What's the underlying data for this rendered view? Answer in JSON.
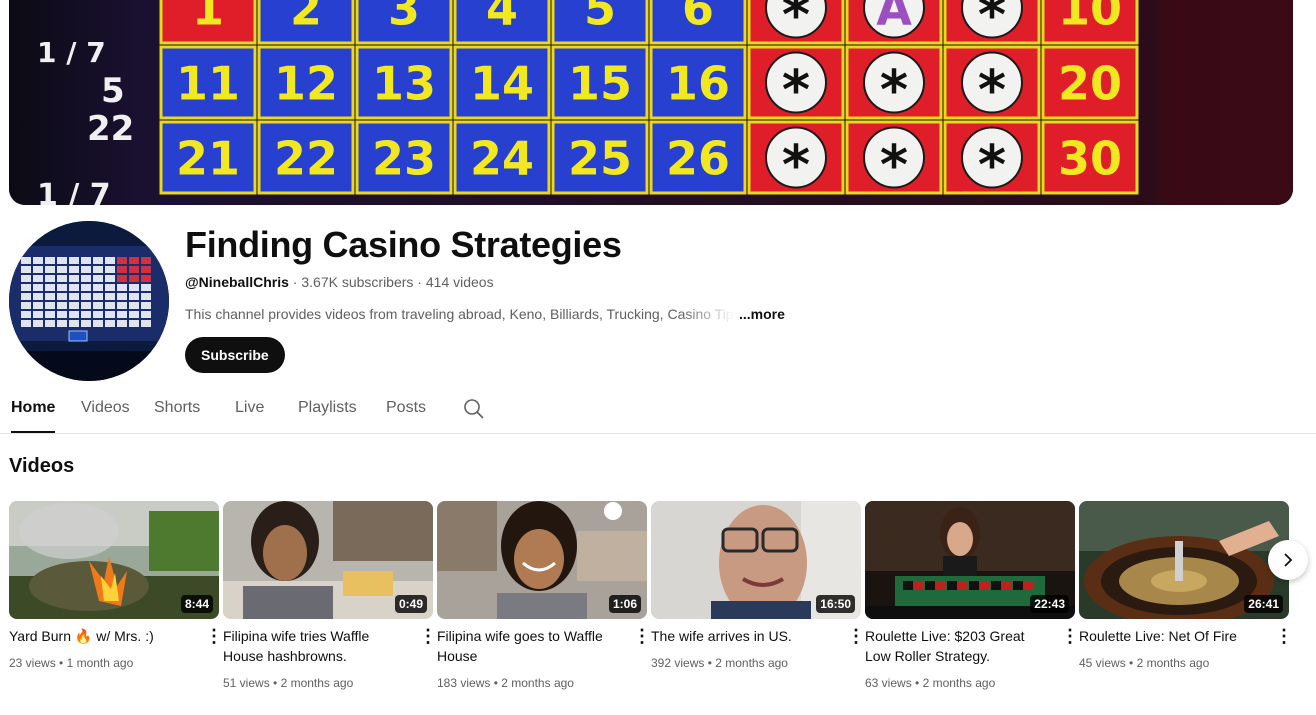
{
  "banner": {
    "side_numbers": [
      "1 / 7",
      "5",
      "22",
      "1 / 7"
    ],
    "row1": [
      "1",
      "2",
      "3",
      "4",
      "5",
      "6",
      "*",
      "A",
      "*",
      "10"
    ],
    "row2": [
      "11",
      "12",
      "13",
      "14",
      "15",
      "16",
      "*",
      "*",
      "*",
      "20"
    ],
    "row3": [
      "21",
      "22",
      "23",
      "24",
      "25",
      "26",
      "*",
      "*",
      "*",
      "30"
    ]
  },
  "channel": {
    "name": "Finding Casino Strategies",
    "handle": "@NineballChris",
    "separator": " · ",
    "subscribers": "3.67K subscribers",
    "videos_count": "414 videos",
    "description": "This channel provides videos from traveling abroad, Keno, Billiards, Trucking, Casino Tips",
    "more_label": "...more",
    "subscribe_label": "Subscribe"
  },
  "tabs": [
    {
      "label": "Home",
      "active": true
    },
    {
      "label": "Videos"
    },
    {
      "label": "Shorts"
    },
    {
      "label": "Live"
    },
    {
      "label": "Playlists"
    },
    {
      "label": "Posts"
    }
  ],
  "section": {
    "title": "Videos"
  },
  "videos": [
    {
      "title": "Yard Burn 🔥 w/ Mrs. :)",
      "duration": "8:44",
      "views": "23 views",
      "age": "1 month ago"
    },
    {
      "title": "Filipina wife tries Waffle House hashbrowns.",
      "duration": "0:49",
      "views": "51 views",
      "age": "2 months ago"
    },
    {
      "title": "Filipina wife goes to Waffle House",
      "duration": "1:06",
      "views": "183 views",
      "age": "2 months ago"
    },
    {
      "title": "The wife arrives in US.",
      "duration": "16:50",
      "views": "392 views",
      "age": "2 months ago"
    },
    {
      "title": "Roulette Live: $203 Great Low Roller Strategy.",
      "duration": "22:43",
      "views": "63 views",
      "age": "2 months ago"
    },
    {
      "title": "Roulette Live: Net Of Fire",
      "duration": "26:41",
      "views": "45 views",
      "age": "2 months ago"
    }
  ],
  "meta_dot": " • ",
  "icons": {
    "search": "search-icon",
    "next": "chevron-right-icon",
    "more": "more-vert-icon"
  }
}
